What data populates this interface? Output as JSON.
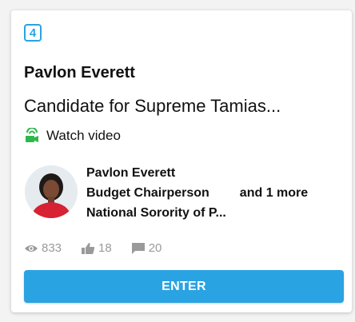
{
  "card": {
    "rank_badge": "4",
    "author_name": "Pavlon Everett",
    "title": "Candidate for Supreme Tamias...",
    "watch_video_label": "Watch video",
    "icons": {
      "video": "video-camera-icon",
      "views": "eye-icon",
      "likes": "thumbs-up-icon",
      "comments": "comment-icon"
    },
    "candidate": {
      "name": "Pavlon Everett",
      "role": "Budget Chairperson",
      "more": "and 1 more",
      "organization": "National Sorority of P..."
    },
    "stats": {
      "views": "833",
      "likes": "18",
      "comments": "20"
    },
    "enter_label": "ENTER"
  },
  "colors": {
    "accent": "#2aa3e3",
    "video_icon": "#2db84c",
    "stat_gray": "#9a9a9a"
  }
}
